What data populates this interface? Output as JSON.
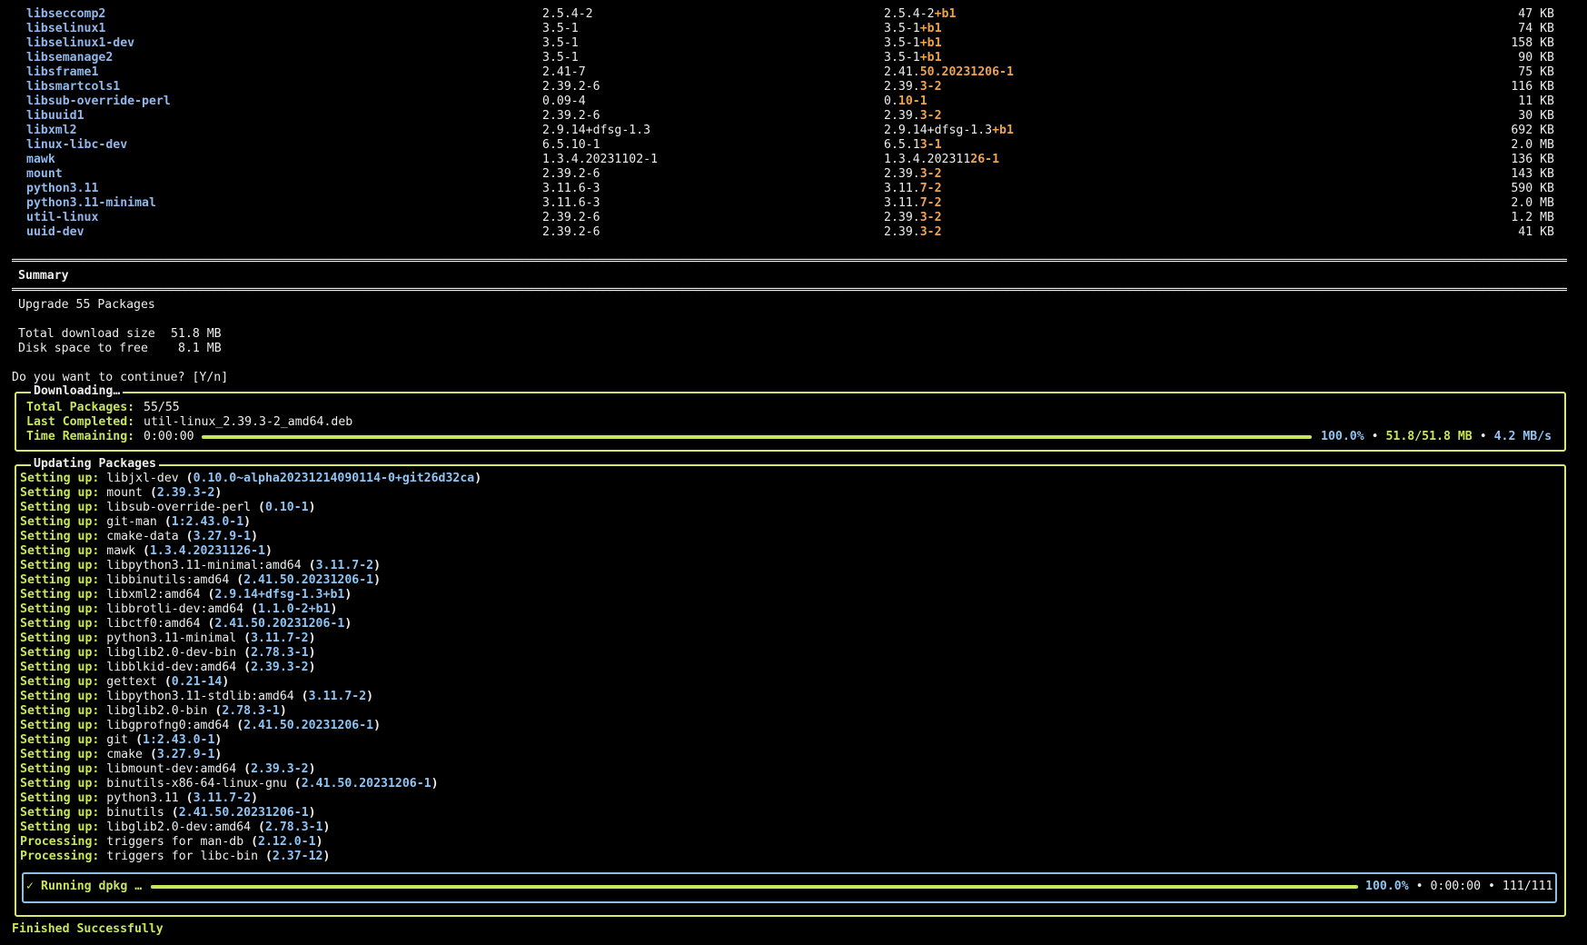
{
  "packages": [
    {
      "name": "libseccomp2",
      "old": "2.5.4-2",
      "new_prefix": "2.5.4-2",
      "new_suffix": "+b1",
      "size": "47 KB"
    },
    {
      "name": "libselinux1",
      "old": "3.5-1",
      "new_prefix": "3.5-1",
      "new_suffix": "+b1",
      "size": "74 KB"
    },
    {
      "name": "libselinux1-dev",
      "old": "3.5-1",
      "new_prefix": "3.5-1",
      "new_suffix": "+b1",
      "size": "158 KB"
    },
    {
      "name": "libsemanage2",
      "old": "3.5-1",
      "new_prefix": "3.5-1",
      "new_suffix": "+b1",
      "size": "90 KB"
    },
    {
      "name": "libsframe1",
      "old": "2.41-7",
      "new_prefix": "2.41.",
      "new_suffix": "50.20231206-1",
      "size": "75 KB"
    },
    {
      "name": "libsmartcols1",
      "old": "2.39.2-6",
      "new_prefix": "2.39.",
      "new_suffix": "3-2",
      "size": "116 KB"
    },
    {
      "name": "libsub-override-perl",
      "old": "0.09-4",
      "new_prefix": "0.",
      "new_suffix": "10-1",
      "size": "11 KB"
    },
    {
      "name": "libuuid1",
      "old": "2.39.2-6",
      "new_prefix": "2.39.",
      "new_suffix": "3-2",
      "size": "30 KB"
    },
    {
      "name": "libxml2",
      "old": "2.9.14+dfsg-1.3",
      "new_prefix": "2.9.14+dfsg-1.3",
      "new_suffix": "+b1",
      "size": "692 KB"
    },
    {
      "name": "linux-libc-dev",
      "old": "6.5.10-1",
      "new_prefix": "6.5.1",
      "new_suffix": "3-1",
      "size": "2.0 MB"
    },
    {
      "name": "mawk",
      "old": "1.3.4.20231102-1",
      "new_prefix": "1.3.4.202311",
      "new_suffix": "26-1",
      "size": "136 KB"
    },
    {
      "name": "mount",
      "old": "2.39.2-6",
      "new_prefix": "2.39.",
      "new_suffix": "3-2",
      "size": "143 KB"
    },
    {
      "name": "python3.11",
      "old": "3.11.6-3",
      "new_prefix": "3.11.",
      "new_suffix": "7-2",
      "size": "590 KB"
    },
    {
      "name": "python3.11-minimal",
      "old": "3.11.6-3",
      "new_prefix": "3.11.",
      "new_suffix": "7-2",
      "size": "2.0 MB"
    },
    {
      "name": "util-linux",
      "old": "2.39.2-6",
      "new_prefix": "2.39.",
      "new_suffix": "3-2",
      "size": "1.2 MB"
    },
    {
      "name": "uuid-dev",
      "old": "2.39.2-6",
      "new_prefix": "2.39.",
      "new_suffix": "3-2",
      "size": "41 KB"
    }
  ],
  "summary": {
    "title": "Summary",
    "upgrade": "Upgrade 55 Packages",
    "download_label": "Total download size",
    "download_value": "51.8 MB",
    "disk_label": "Disk space to free",
    "disk_value": "8.1 MB",
    "prompt": "Do you want to continue? [Y/n]"
  },
  "downloading": {
    "title": "Downloading…",
    "total_label": "Total Packages:",
    "total_value": "55/55",
    "last_label": "Last Completed:",
    "last_value": "util-linux_2.39.3-2_amd64.deb",
    "time_label": "Time Remaining:",
    "time_value": "0:00:00",
    "progress": 1.0,
    "percent": "100.0%",
    "size": "51.8/51.8 MB",
    "speed": "4.2 MB/s"
  },
  "updating": {
    "title": "Updating Packages",
    "lines": [
      {
        "label": "Setting up:",
        "pkg": "libjxl-dev",
        "ver": "0.10.0~alpha20231214090114-0+git26d32ca"
      },
      {
        "label": "Setting up:",
        "pkg": "mount",
        "ver": "2.39.3-2"
      },
      {
        "label": "Setting up:",
        "pkg": "libsub-override-perl",
        "ver": "0.10-1"
      },
      {
        "label": "Setting up:",
        "pkg": "git-man",
        "ver": "1:2.43.0-1"
      },
      {
        "label": "Setting up:",
        "pkg": "cmake-data",
        "ver": "3.27.9-1"
      },
      {
        "label": "Setting up:",
        "pkg": "mawk",
        "ver": "1.3.4.20231126-1"
      },
      {
        "label": "Setting up:",
        "pkg": "libpython3.11-minimal:amd64",
        "ver": "3.11.7-2"
      },
      {
        "label": "Setting up:",
        "pkg": "libbinutils:amd64",
        "ver": "2.41.50.20231206-1"
      },
      {
        "label": "Setting up:",
        "pkg": "libxml2:amd64",
        "ver": "2.9.14+dfsg-1.3+b1"
      },
      {
        "label": "Setting up:",
        "pkg": "libbrotli-dev:amd64",
        "ver": "1.1.0-2+b1"
      },
      {
        "label": "Setting up:",
        "pkg": "libctf0:amd64",
        "ver": "2.41.50.20231206-1"
      },
      {
        "label": "Setting up:",
        "pkg": "python3.11-minimal",
        "ver": "3.11.7-2"
      },
      {
        "label": "Setting up:",
        "pkg": "libglib2.0-dev-bin",
        "ver": "2.78.3-1"
      },
      {
        "label": "Setting up:",
        "pkg": "libblkid-dev:amd64",
        "ver": "2.39.3-2"
      },
      {
        "label": "Setting up:",
        "pkg": "gettext",
        "ver": "0.21-14"
      },
      {
        "label": "Setting up:",
        "pkg": "libpython3.11-stdlib:amd64",
        "ver": "3.11.7-2"
      },
      {
        "label": "Setting up:",
        "pkg": "libglib2.0-bin",
        "ver": "2.78.3-1"
      },
      {
        "label": "Setting up:",
        "pkg": "libgprofng0:amd64",
        "ver": "2.41.50.20231206-1"
      },
      {
        "label": "Setting up:",
        "pkg": "git",
        "ver": "1:2.43.0-1"
      },
      {
        "label": "Setting up:",
        "pkg": "cmake",
        "ver": "3.27.9-1"
      },
      {
        "label": "Setting up:",
        "pkg": "libmount-dev:amd64",
        "ver": "2.39.3-2"
      },
      {
        "label": "Setting up:",
        "pkg": "binutils-x86-64-linux-gnu",
        "ver": "2.41.50.20231206-1"
      },
      {
        "label": "Setting up:",
        "pkg": "python3.11",
        "ver": "3.11.7-2"
      },
      {
        "label": "Setting up:",
        "pkg": "binutils",
        "ver": "2.41.50.20231206-1"
      },
      {
        "label": "Setting up:",
        "pkg": "libglib2.0-dev:amd64",
        "ver": "2.78.3-1"
      },
      {
        "label": "Processing:",
        "pkg": "triggers for man-db",
        "ver": "2.12.0-1"
      },
      {
        "label": "Processing:",
        "pkg": "triggers for libc-bin",
        "ver": "2.37-12"
      }
    ]
  },
  "dpkg": {
    "check": "✓",
    "label": "Running dpkg …",
    "progress": 1.0,
    "percent": "100.0%",
    "time": "0:00:00",
    "count": "111/111"
  },
  "finished": "Finished Successfully",
  "colors": {
    "accent_green": "#c8e65a",
    "package_blue": "#8fb8ee",
    "version_orange": "#f0a24a",
    "panel_border": "#d4ea6c",
    "inner_border": "#8fbfe0"
  }
}
